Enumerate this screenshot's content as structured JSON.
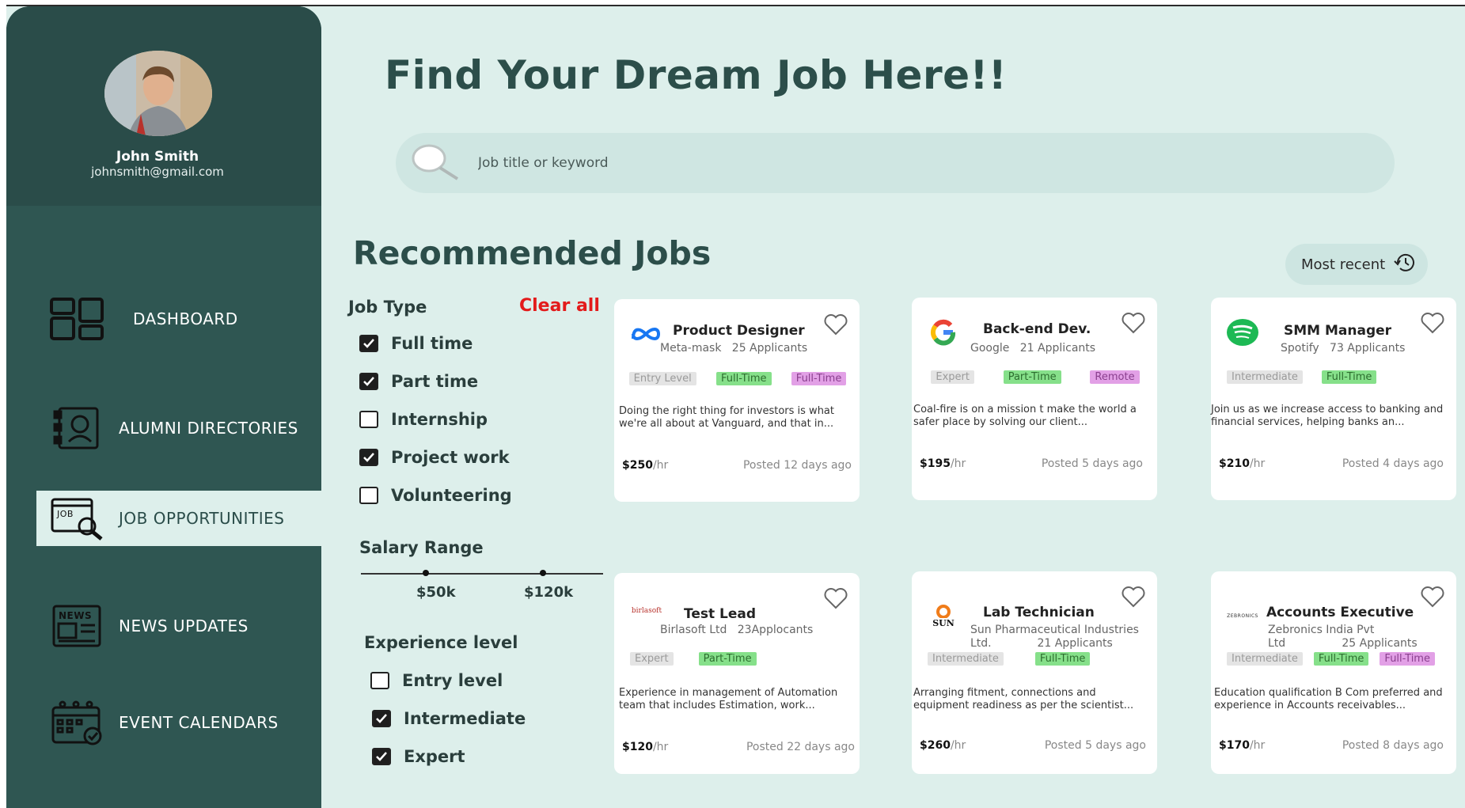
{
  "user": {
    "name": "John Smith",
    "email": "johnsmith@gmail.com"
  },
  "nav": [
    {
      "label": "DASHBOARD",
      "icon": "dashboard-icon"
    },
    {
      "label": "ALUMNI DIRECTORIES",
      "icon": "directory-icon"
    },
    {
      "label": "JOB OPPORTUNITIES",
      "icon": "job-search-icon",
      "active": true
    },
    {
      "label": "NEWS UPDATES",
      "icon": "newspaper-icon"
    },
    {
      "label": "EVENT CALENDARS",
      "icon": "calendar-icon"
    }
  ],
  "header": {
    "title": "Find Your Dream Job Here!!"
  },
  "search": {
    "placeholder": "Job title or keyword"
  },
  "recommended": {
    "title": "Recommended Jobs",
    "sort_label": "Most recent"
  },
  "filters": {
    "job_type_title": "Job Type",
    "clear_all": "Clear all",
    "job_types": [
      {
        "label": "Full time",
        "checked": true
      },
      {
        "label": "Part time",
        "checked": true
      },
      {
        "label": "Internship",
        "checked": false
      },
      {
        "label": "Project work",
        "checked": true
      },
      {
        "label": "Volunteering",
        "checked": false
      }
    ],
    "salary_title": "Salary Range",
    "salary_min": "$50k",
    "salary_max": "$120k",
    "experience_title": "Experience level",
    "experience_levels": [
      {
        "label": "Entry level",
        "checked": false
      },
      {
        "label": "Intermediate",
        "checked": true
      },
      {
        "label": "Expert",
        "checked": true
      }
    ]
  },
  "jobs": [
    {
      "title": "Product Designer",
      "company": "Meta-mask",
      "applicants": "25 Applicants",
      "tags": [
        {
          "text": "Entry Level",
          "color": "gray"
        },
        {
          "text": "Full-Time",
          "color": "green"
        },
        {
          "text": "Full-Time",
          "color": "purple"
        }
      ],
      "description": "Doing the right thing for investors is what we're all about at Vanguard, and that in...",
      "rate": "$250",
      "rate_unit": "/hr",
      "posted": "Posted 12 days ago",
      "logo": "meta-logo-icon"
    },
    {
      "title": "Back-end Dev.",
      "company": "Google",
      "applicants": "21 Applicants",
      "tags": [
        {
          "text": "Expert",
          "color": "gray"
        },
        {
          "text": "Part-Time",
          "color": "green"
        },
        {
          "text": "Remote",
          "color": "purple"
        }
      ],
      "description": "Coal-fire is on a mission t make the world a safer place by solving our client...",
      "rate": "$195",
      "rate_unit": "/hr",
      "posted": "Posted 5 days ago",
      "logo": "google-logo-icon"
    },
    {
      "title": "SMM Manager",
      "company": "Spotify",
      "applicants": "73 Applicants",
      "tags": [
        {
          "text": "Intermediate",
          "color": "gray"
        },
        {
          "text": "Full-Time",
          "color": "green"
        }
      ],
      "description": "Join us as we increase access to banking and financial services, helping banks an...",
      "rate": "$210",
      "rate_unit": "/hr",
      "posted": "Posted 4 days ago",
      "logo": "spotify-logo-icon"
    },
    {
      "title": "Test Lead",
      "company": "Birlasoft Ltd",
      "applicants": "23Applocants",
      "tags": [
        {
          "text": "Expert",
          "color": "gray"
        },
        {
          "text": "Part-Time",
          "color": "green"
        }
      ],
      "description": "Experience in management of Automation team that includes Estimation, work...",
      "rate": "$120",
      "rate_unit": "/hr",
      "posted": "Posted 22 days ago",
      "logo": "birlasoft-logo-icon",
      "logo_text": "birlasoft"
    },
    {
      "title": "Lab Technician",
      "company": "Sun Pharmaceutical Industries Ltd.",
      "applicants": "21 Applicants",
      "tags": [
        {
          "text": "Intermediate",
          "color": "gray"
        },
        {
          "text": "Full-Time",
          "color": "green"
        }
      ],
      "description": "Arranging fitment, connections and equipment readiness as per the scientist...",
      "rate": "$260",
      "rate_unit": "/hr",
      "posted": "Posted 5 days ago",
      "logo": "sun-pharma-logo-icon",
      "logo_text": "SUN"
    },
    {
      "title": "Accounts Executive",
      "company": "Zebronics India Pvt Ltd",
      "applicants": "25 Applicants",
      "tags": [
        {
          "text": "Intermediate",
          "color": "gray"
        },
        {
          "text": "Full-Time",
          "color": "green"
        },
        {
          "text": "Full-Time",
          "color": "purple"
        }
      ],
      "description": "Education qualification B Com preferred and experience in Accounts receivables...",
      "rate": "$170",
      "rate_unit": "/hr",
      "posted": "Posted 8 days ago",
      "logo": "zebronics-logo-icon",
      "logo_text": "ZEBRONICS"
    }
  ],
  "colors": {
    "sidebar": "#2f5652",
    "profile_bg": "#2a4c49",
    "page_bg": "#ddefeb",
    "accent_red": "#e31b1b"
  }
}
